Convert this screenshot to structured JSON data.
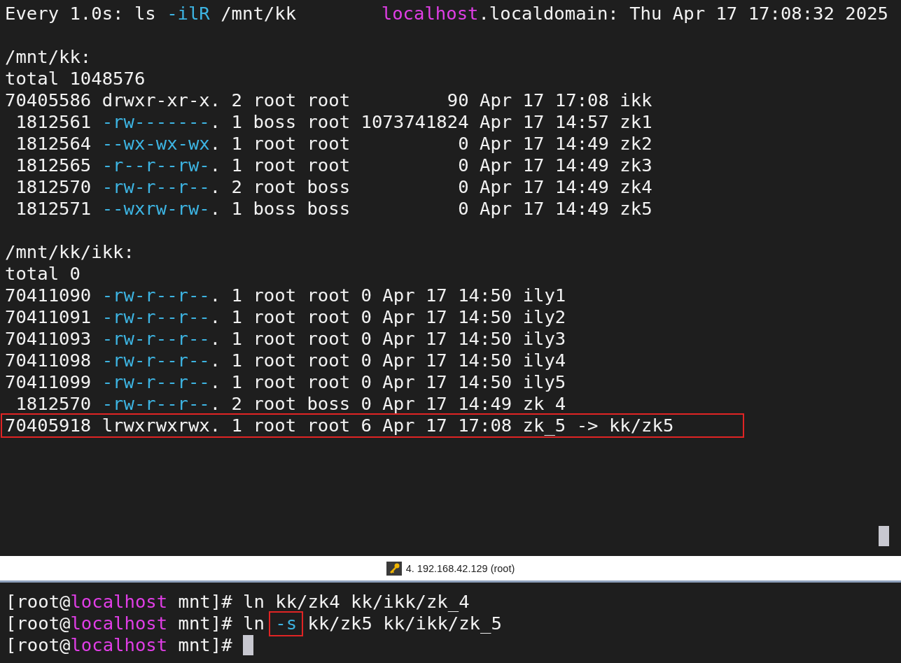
{
  "watch_pane": {
    "header": {
      "left": [
        {
          "kind": "plain",
          "text": "Every 1.0s: ls "
        },
        {
          "kind": "flag",
          "text": "-ilR"
        },
        {
          "kind": "plain",
          "text": " /mnt/kk"
        }
      ],
      "right": [
        {
          "kind": "host",
          "text": "localhost"
        },
        {
          "kind": "plain",
          "text": ".localdomain: Thu Apr 17 17:08:32 2025"
        }
      ]
    },
    "listings": [
      {
        "lines": [
          {
            "highlighted": false,
            "segments": [
              {
                "kind": "plain",
                "text": "/mnt/kk:"
              }
            ]
          },
          {
            "highlighted": false,
            "segments": [
              {
                "kind": "plain",
                "text": "total 1048576"
              }
            ]
          },
          {
            "highlighted": false,
            "segments": [
              {
                "kind": "plain",
                "text": "70405586 drwxr-xr-x. 2 root root         90 Apr 17 17:08 ikk"
              }
            ]
          },
          {
            "highlighted": false,
            "segments": [
              {
                "kind": "plain",
                "text": " 1812561 "
              },
              {
                "kind": "flag",
                "text": "-rw-------"
              },
              {
                "kind": "plain",
                "text": ". 1 boss root 1073741824 Apr 17 14:57 zk1"
              }
            ]
          },
          {
            "highlighted": false,
            "segments": [
              {
                "kind": "plain",
                "text": " 1812564 "
              },
              {
                "kind": "flag",
                "text": "--wx-wx-wx"
              },
              {
                "kind": "plain",
                "text": ". 1 root root          0 Apr 17 14:49 zk2"
              }
            ]
          },
          {
            "highlighted": false,
            "segments": [
              {
                "kind": "plain",
                "text": " 1812565 "
              },
              {
                "kind": "flag",
                "text": "-r--r--rw-"
              },
              {
                "kind": "plain",
                "text": ". 1 root root          0 Apr 17 14:49 zk3"
              }
            ]
          },
          {
            "highlighted": false,
            "segments": [
              {
                "kind": "plain",
                "text": " 1812570 "
              },
              {
                "kind": "flag",
                "text": "-rw-r--r--"
              },
              {
                "kind": "plain",
                "text": ". 2 root boss          0 Apr 17 14:49 zk4"
              }
            ]
          },
          {
            "highlighted": false,
            "segments": [
              {
                "kind": "plain",
                "text": " 1812571 "
              },
              {
                "kind": "flag",
                "text": "--wxrw-rw-"
              },
              {
                "kind": "plain",
                "text": ". 1 boss boss          0 Apr 17 14:49 zk5"
              }
            ]
          }
        ]
      },
      {
        "lines": [
          {
            "highlighted": false,
            "segments": [
              {
                "kind": "plain",
                "text": "/mnt/kk/ikk:"
              }
            ]
          },
          {
            "highlighted": false,
            "segments": [
              {
                "kind": "plain",
                "text": "total 0"
              }
            ]
          },
          {
            "highlighted": false,
            "segments": [
              {
                "kind": "plain",
                "text": "70411090 "
              },
              {
                "kind": "flag",
                "text": "-rw-r--r--"
              },
              {
                "kind": "plain",
                "text": ". 1 root root 0 Apr 17 14:50 ily1"
              }
            ]
          },
          {
            "highlighted": false,
            "segments": [
              {
                "kind": "plain",
                "text": "70411091 "
              },
              {
                "kind": "flag",
                "text": "-rw-r--r--"
              },
              {
                "kind": "plain",
                "text": ". 1 root root 0 Apr 17 14:50 ily2"
              }
            ]
          },
          {
            "highlighted": false,
            "segments": [
              {
                "kind": "plain",
                "text": "70411093 "
              },
              {
                "kind": "flag",
                "text": "-rw-r--r--"
              },
              {
                "kind": "plain",
                "text": ". 1 root root 0 Apr 17 14:50 ily3"
              }
            ]
          },
          {
            "highlighted": false,
            "segments": [
              {
                "kind": "plain",
                "text": "70411098 "
              },
              {
                "kind": "flag",
                "text": "-rw-r--r--"
              },
              {
                "kind": "plain",
                "text": ". 1 root root 0 Apr 17 14:50 ily4"
              }
            ]
          },
          {
            "highlighted": false,
            "segments": [
              {
                "kind": "plain",
                "text": "70411099 "
              },
              {
                "kind": "flag",
                "text": "-rw-r--r--"
              },
              {
                "kind": "plain",
                "text": ". 1 root root 0 Apr 17 14:50 ily5"
              }
            ]
          },
          {
            "highlighted": false,
            "segments": [
              {
                "kind": "plain",
                "text": " 1812570 "
              },
              {
                "kind": "flag",
                "text": "-rw-r--r--"
              },
              {
                "kind": "plain",
                "text": ". 2 root boss 0 Apr 17 14:49 zk 4"
              }
            ]
          },
          {
            "highlighted": true,
            "segments": [
              {
                "kind": "plain",
                "text": "70405918 lrwxrwxrwx. 1 root root 6 Apr 17 17:08 zk_5 -> kk/zk5"
              }
            ]
          }
        ]
      }
    ]
  },
  "session_tab": {
    "title": "4. 192.168.42.129 (root)"
  },
  "shell_pane": {
    "lines": [
      {
        "segments": [
          {
            "kind": "plain",
            "text": "[root@"
          },
          {
            "kind": "host",
            "text": "localhost"
          },
          {
            "kind": "plain",
            "text": " mnt]# ln kk/zk4 kk/ikk/zk_4"
          }
        ]
      },
      {
        "segments": [
          {
            "kind": "plain",
            "text": "[root@"
          },
          {
            "kind": "host",
            "text": "localhost"
          },
          {
            "kind": "plain",
            "text": " mnt]# ln "
          },
          {
            "kind": "boxed-flag",
            "text": "-s"
          },
          {
            "kind": "plain",
            "text": " kk/zk5 kk/ikk/zk_5"
          }
        ]
      },
      {
        "segments": [
          {
            "kind": "plain",
            "text": "[root@"
          },
          {
            "kind": "host",
            "text": "localhost"
          },
          {
            "kind": "plain",
            "text": " mnt]# "
          }
        ]
      }
    ]
  }
}
